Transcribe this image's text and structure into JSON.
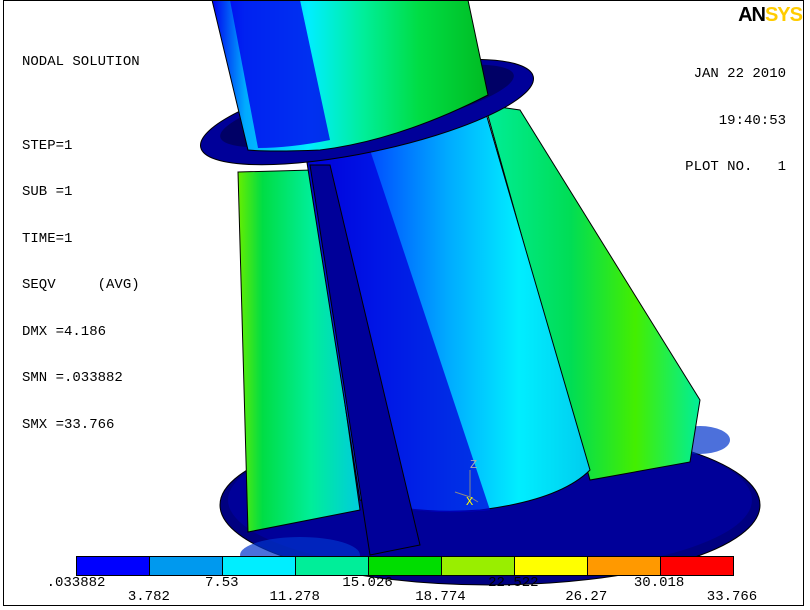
{
  "info": {
    "title": "NODAL SOLUTION",
    "step": "STEP=1",
    "sub": "SUB =1",
    "time": "TIME=1",
    "seqv": "SEQV     (AVG)",
    "dmx": "DMX =4.186",
    "smn": "SMN =.033882",
    "smx": "SMX =33.766"
  },
  "header_right": {
    "logo_an": "AN",
    "logo_sys": "SYS",
    "date": "JAN 22 2010",
    "time": "19:40:53",
    "plot_no": "PLOT NO.   1"
  },
  "triad": {
    "z_label": "Z",
    "x_label": "X"
  },
  "legend": {
    "colors": [
      "#0000ff",
      "#0099ee",
      "#00eeff",
      "#00ee99",
      "#00dd00",
      "#99ee00",
      "#ffff00",
      "#ff9900",
      "#ff0000"
    ],
    "labels_top": [
      ".033882",
      "7.53",
      "15.026",
      "22.522",
      "30.018"
    ],
    "labels_bottom": [
      "3.782",
      "11.278",
      "18.774",
      "26.27",
      "33.766"
    ]
  }
}
